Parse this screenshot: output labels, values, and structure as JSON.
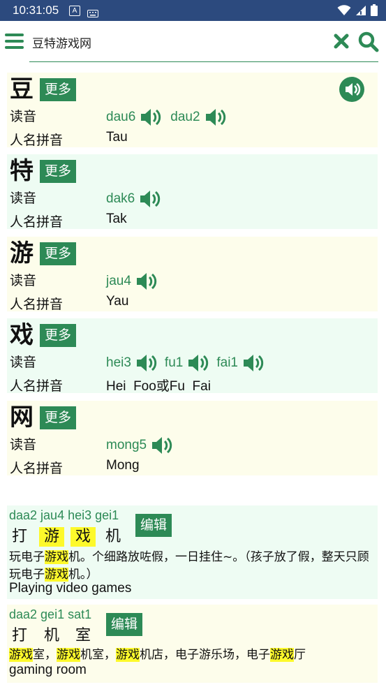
{
  "status": {
    "time": "10:31:05",
    "a_icon": "A"
  },
  "search": {
    "value": "豆特游戏网"
  },
  "labels": {
    "reading": "读音",
    "name_pinyin": "人名拼音",
    "more": "更多",
    "edit": "编辑"
  },
  "characters": [
    {
      "char": "豆",
      "readings": [
        "dau6",
        "dau2"
      ],
      "name_pinyin": "Tau"
    },
    {
      "char": "特",
      "readings": [
        "dak6"
      ],
      "name_pinyin": "Tak"
    },
    {
      "char": "游",
      "readings": [
        "jau4"
      ],
      "name_pinyin": "Yau"
    },
    {
      "char": "戏",
      "readings": [
        "hei3",
        "fu1",
        "fai1"
      ],
      "name_pinyin": "Hei  Foo或Fu  Fai"
    },
    {
      "char": "网",
      "readings": [
        "mong5"
      ],
      "name_pinyin": "Mong"
    }
  ],
  "phrases": [
    {
      "jyutping": "daa2 jau4 hei3 gei1",
      "chars": [
        "打",
        "游",
        "戏",
        "机"
      ],
      "example_line1": [
        "玩电子",
        "游戏",
        "机。个细路放咗假，一日挂住~。（孩子放了假，整天只顾"
      ],
      "example_line2": [
        "玩电子",
        "游戏",
        "机。）"
      ],
      "english": "Playing video games"
    },
    {
      "jyutping": "daa2 gei1 sat1",
      "chars": [
        "打",
        "机",
        "室"
      ],
      "example_line1": [
        "游戏",
        "室，",
        "游戏",
        "机室，",
        "游戏",
        "机店，电子游乐场，电子",
        "游戏",
        "厅"
      ],
      "english": "gaming room"
    }
  ],
  "colors": {
    "accent": "#2d8a56",
    "statusbar": "#2c4a7e",
    "highlight": "#fdf92b",
    "card_yellow": "#fdfdeb",
    "card_green": "#eefcf3"
  }
}
